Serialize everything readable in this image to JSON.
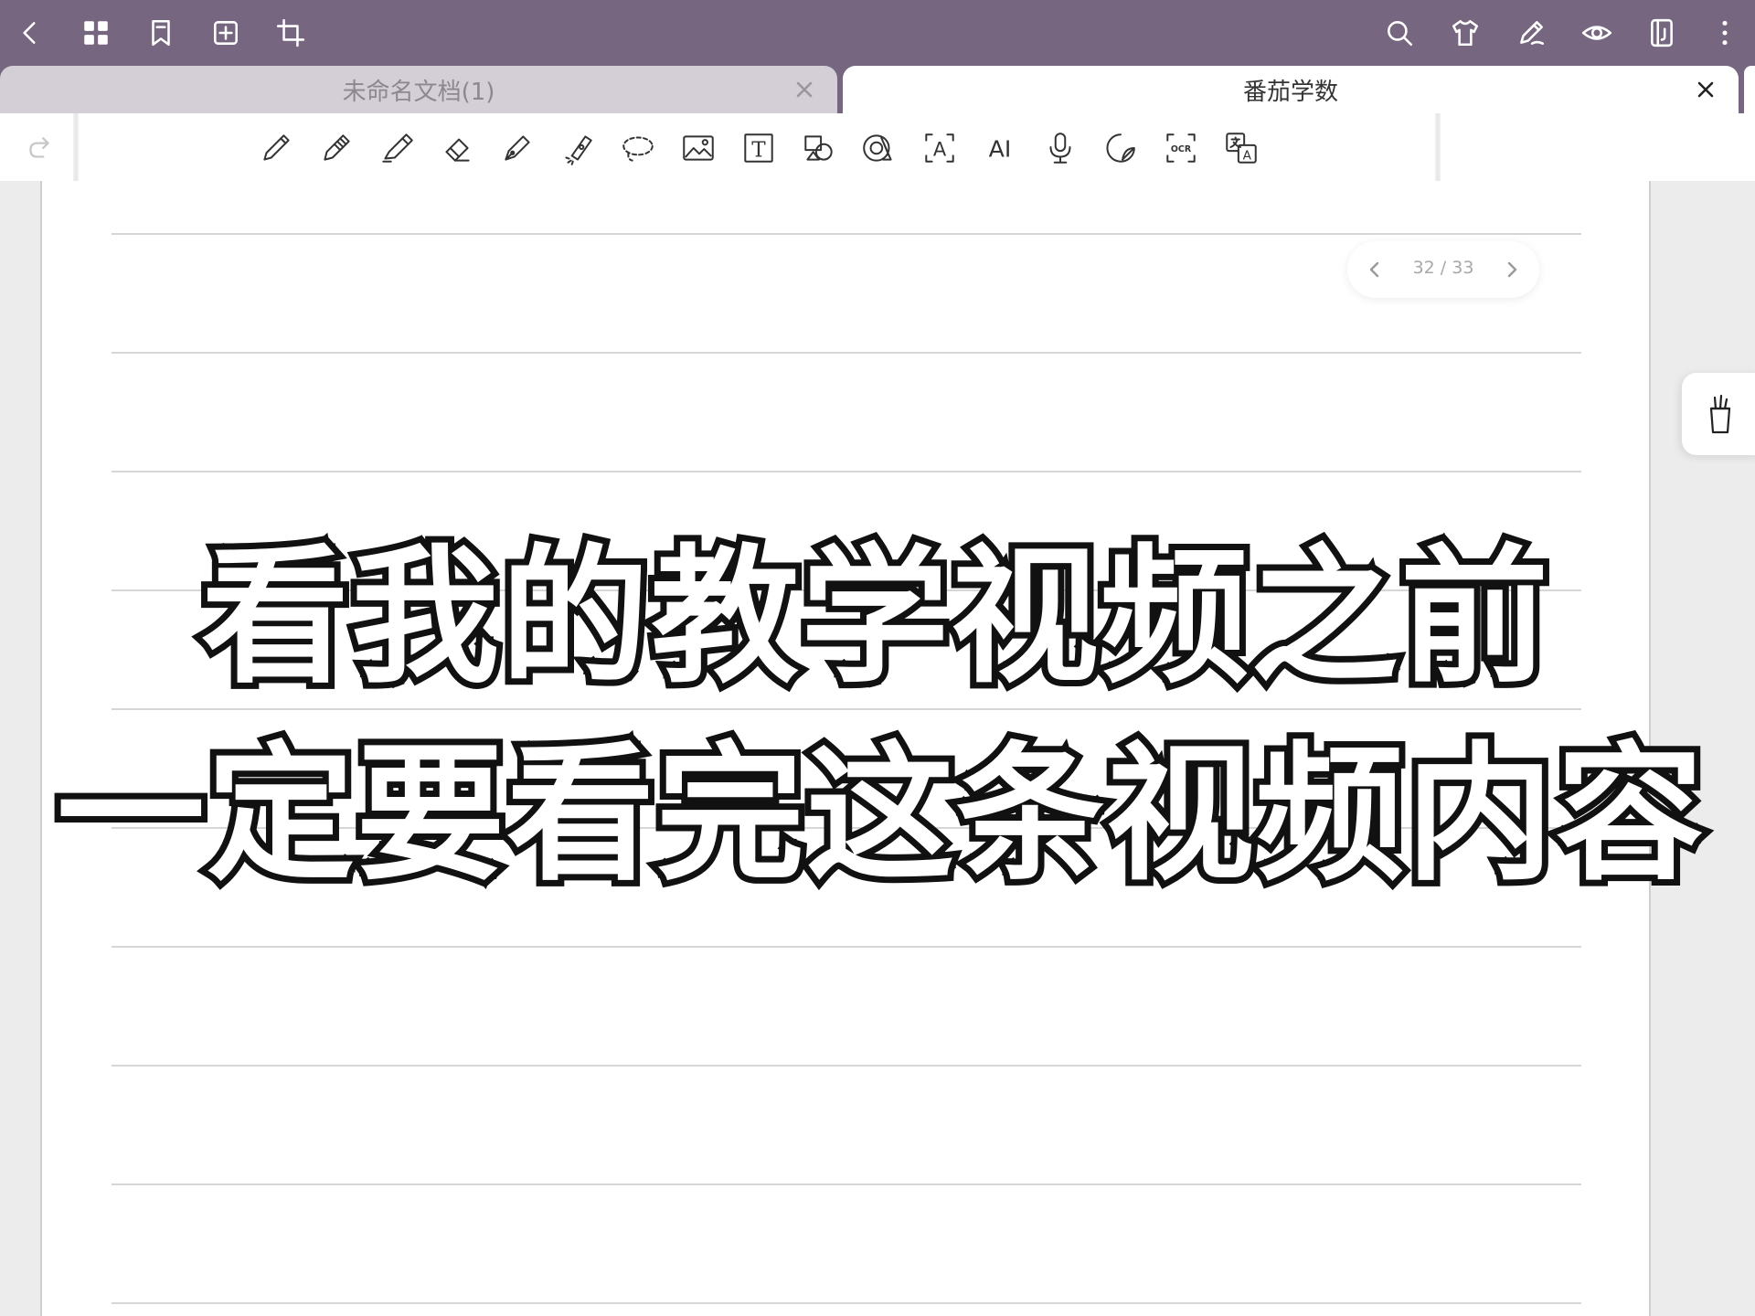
{
  "topbar": {
    "left_icons": [
      "back-icon",
      "grid-icon",
      "bookmark-icon",
      "add-page-icon",
      "crop-icon"
    ],
    "right_icons": [
      "search-icon",
      "shirt-icon",
      "pen-edit-icon",
      "eye-icon",
      "page-layout-icon",
      "more-icon"
    ]
  },
  "tabs": [
    {
      "label": "未命名文档(1)",
      "active": false
    },
    {
      "label": "番茄学数",
      "active": true
    }
  ],
  "toolbar": {
    "tools": [
      "pen-icon",
      "pencil-icon",
      "highlighter-icon",
      "eraser-icon",
      "fountain-pen-icon",
      "laser-pointer-icon",
      "lasso-icon",
      "image-icon",
      "text-box-icon",
      "shapes-icon",
      "tape-icon",
      "text-recognition-icon",
      "ai-icon",
      "microphone-icon",
      "sticker-icon",
      "ocr-icon",
      "translate-icon"
    ],
    "ai_label": "AI",
    "text_tool_label": "T",
    "recog_label": "A",
    "ocr_label": "OCR",
    "translate_label": "A"
  },
  "pager": {
    "current": "32",
    "total": "33",
    "text": "32 / 33"
  },
  "caption": {
    "line1": "看我的教学视频之前",
    "line2": "一定要看完这条视频内容"
  },
  "colors": {
    "topbar": "#76667f",
    "tab_inactive": "#d4cfd6",
    "tab_active": "#ffffff",
    "caption_fill": "#ffffff",
    "caption_stroke": "#111111"
  }
}
